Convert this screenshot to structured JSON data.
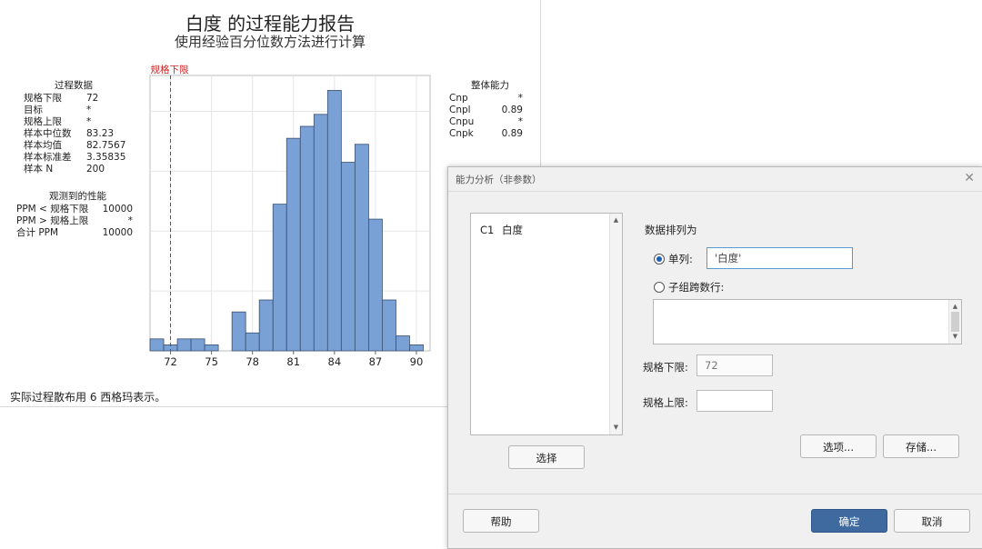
{
  "report": {
    "title": "白度 的过程能力报告",
    "subtitle": "使用经验百分位数方法进行计算",
    "process_data": {
      "header": "过程数据",
      "rows": [
        {
          "label": "规格下限",
          "value": "72"
        },
        {
          "label": "目标",
          "value": "*"
        },
        {
          "label": "规格上限",
          "value": "*"
        },
        {
          "label": "样本中位数",
          "value": "83.23"
        },
        {
          "label": "样本均值",
          "value": "82.7567"
        },
        {
          "label": "样本标准差",
          "value": "3.35835"
        },
        {
          "label": "样本 N",
          "value": "200"
        }
      ]
    },
    "observed": {
      "header": "观测到的性能",
      "rows": [
        {
          "label": "PPM < 规格下限",
          "value": "10000"
        },
        {
          "label": "PPM > 规格上限",
          "value": "*"
        },
        {
          "label": "合计 PPM",
          "value": "10000"
        }
      ]
    },
    "overall": {
      "header": "整体能力",
      "rows": [
        {
          "label": "Cnp",
          "value": "*"
        },
        {
          "label": "Cnpl",
          "value": "0.89"
        },
        {
          "label": "Cnpu",
          "value": "*"
        },
        {
          "label": "Cnpk",
          "value": "0.89"
        }
      ]
    },
    "footer": "实际过程散布用 6 西格玛表示。"
  },
  "chart_data": {
    "type": "bar",
    "title": "",
    "xlabel": "",
    "ylabel": "",
    "bin_width": 1,
    "bin_starts": [
      70.5,
      71.5,
      72.5,
      73.5,
      74.5,
      75.5,
      76.5,
      77.5,
      78.5,
      79.5,
      80.5,
      81.5,
      82.5,
      83.5,
      84.5,
      85.5,
      86.5,
      87.5,
      88.5,
      89.5
    ],
    "values": [
      4,
      2,
      4,
      4,
      2,
      0,
      13,
      6,
      17,
      49,
      71,
      75,
      79,
      87,
      63,
      69,
      44,
      17,
      5,
      2
    ],
    "xticks": [
      72,
      75,
      78,
      81,
      84,
      87,
      90
    ],
    "xlim": [
      70.5,
      91
    ],
    "ylim": [
      0,
      92
    ],
    "grid": true,
    "bar_color": "#7aa1d6",
    "reference_line": {
      "label": "规格下限",
      "x": 72,
      "color": "#cc2222"
    }
  },
  "dialog": {
    "title": "能力分析（非参数）",
    "close_icon": "close-icon",
    "variable": {
      "id": "C1",
      "name": "白度"
    },
    "select_button": "选择",
    "arrangement_label": "数据排列为",
    "single_column_label": "单列:",
    "single_column_value": "'白度'",
    "subgroups_label": "子组跨数行:",
    "lsl_label": "规格下限:",
    "lsl_value": "72",
    "usl_label": "规格上限:",
    "usl_value": "",
    "options_button": "选项...",
    "storage_button": "存储...",
    "help_button": "帮助",
    "ok_button": "确定",
    "cancel_button": "取消",
    "colors": {
      "ok": "#3e6aa0",
      "radio": "#1b5fb3",
      "focus": "#5b9bd5"
    }
  }
}
